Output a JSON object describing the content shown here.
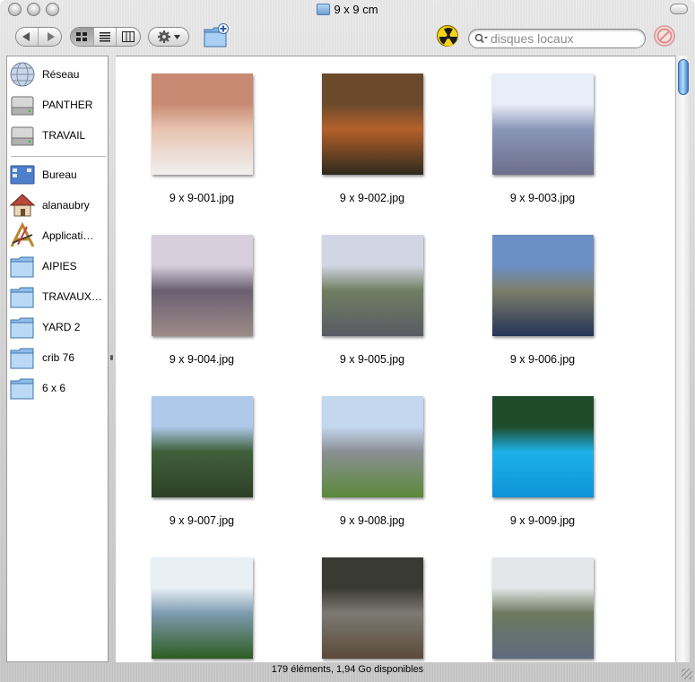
{
  "window": {
    "title": "9 x 9 cm"
  },
  "toolbar": {
    "back_icon": "back-arrow-icon",
    "forward_icon": "forward-arrow-icon",
    "view_modes": [
      "icon-view",
      "list-view",
      "column-view"
    ],
    "active_view": "icon-view",
    "action_icon": "gear-icon",
    "new_folder_icon": "new-folder-icon",
    "burn_icon": "burn-icon",
    "search_placeholder": "disques locaux",
    "stop_icon": "stop-icon"
  },
  "sidebar": {
    "devices": [
      {
        "label": "Réseau",
        "icon": "network-globe-icon"
      },
      {
        "label": "PANTHER",
        "icon": "hard-drive-icon"
      },
      {
        "label": "TRAVAIL",
        "icon": "hard-drive-icon"
      }
    ],
    "places": [
      {
        "label": "Bureau",
        "icon": "desktop-icon"
      },
      {
        "label": "alanaubry",
        "icon": "home-icon"
      },
      {
        "label": "Applicati…",
        "icon": "applications-icon"
      },
      {
        "label": "AIPIES",
        "icon": "folder-icon"
      },
      {
        "label": "TRAVAUX…",
        "icon": "folder-icon"
      },
      {
        "label": "YARD 2",
        "icon": "folder-icon"
      },
      {
        "label": "crib 76",
        "icon": "folder-icon"
      },
      {
        "label": "6 x 6",
        "icon": "folder-icon"
      }
    ]
  },
  "files": [
    {
      "name": "9 x 9-001.jpg",
      "colors": [
        "#c98a73",
        "#e7c4b0",
        "#f0f0f0"
      ]
    },
    {
      "name": "9 x 9-002.jpg",
      "colors": [
        "#6b4a2c",
        "#b5602a",
        "#2d2a1d"
      ]
    },
    {
      "name": "9 x 9-003.jpg",
      "colors": [
        "#e8eef8",
        "#8a96b8",
        "#6c6f8b"
      ]
    },
    {
      "name": "9 x 9-004.jpg",
      "colors": [
        "#d8cfdc",
        "#6b5f70",
        "#9c8b88"
      ]
    },
    {
      "name": "9 x 9-005.jpg",
      "colors": [
        "#d2d6e4",
        "#6f7f62",
        "#5a5a63"
      ]
    },
    {
      "name": "9 x 9-006.jpg",
      "colors": [
        "#6c8fc6",
        "#7d7f6a",
        "#243457"
      ]
    },
    {
      "name": "9 x 9-007.jpg",
      "colors": [
        "#aec9ea",
        "#3f5f3a",
        "#2d4025"
      ]
    },
    {
      "name": "9 x 9-008.jpg",
      "colors": [
        "#c3d7ef",
        "#8a8f93",
        "#5b8a39"
      ]
    },
    {
      "name": "9 x 9-009.jpg",
      "colors": [
        "#1f4b2a",
        "#1db1e8",
        "#0c93d8"
      ]
    },
    {
      "name": "",
      "colors": [
        "#e8f0f6",
        "#7e9bb0",
        "#2d5d22"
      ]
    },
    {
      "name": "",
      "colors": [
        "#3a3a34",
        "#7c7a72",
        "#5c4a3a"
      ]
    },
    {
      "name": "",
      "colors": [
        "#e4e7ea",
        "#6c7a5f",
        "#5f6b7f"
      ]
    }
  ],
  "status": {
    "text": "179 éléments, 1,94 Go disponibles"
  }
}
